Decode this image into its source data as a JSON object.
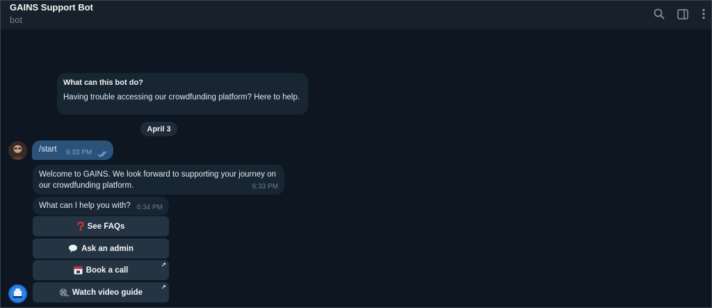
{
  "header": {
    "title": "GAINS Support Bot",
    "subtitle": "bot"
  },
  "intro": {
    "title": "What can this bot do?",
    "text": "Having trouble accessing our crowdfunding platform? Here to help."
  },
  "date_separator": "April 3",
  "messages": [
    {
      "direction": "outgoing",
      "text": "/start",
      "time": "6:33 PM",
      "status": "read"
    },
    {
      "direction": "incoming",
      "text": "Welcome to GAINS. We look forward to supporting your journey on our crowdfunding platform.",
      "time": "6:33 PM"
    },
    {
      "direction": "incoming",
      "text": "What can I help you with?",
      "time": "6:34 PM"
    }
  ],
  "keyboard": [
    {
      "label": "See FAQs",
      "icon": "question-mark-icon",
      "external": false
    },
    {
      "label": "Ask an admin",
      "icon": "speech-bubble-icon",
      "external": false
    },
    {
      "label": "Book a call",
      "icon": "calendar-icon",
      "external": true
    },
    {
      "label": "Watch video guide",
      "icon": "film-reel-icon",
      "external": true
    }
  ],
  "colors": {
    "background": "#0e1621",
    "header": "#17212b",
    "incoming_bubble": "#182533",
    "outgoing_bubble": "#2b5278",
    "keyboard_button": "#243443",
    "muted_text": "#708499"
  }
}
